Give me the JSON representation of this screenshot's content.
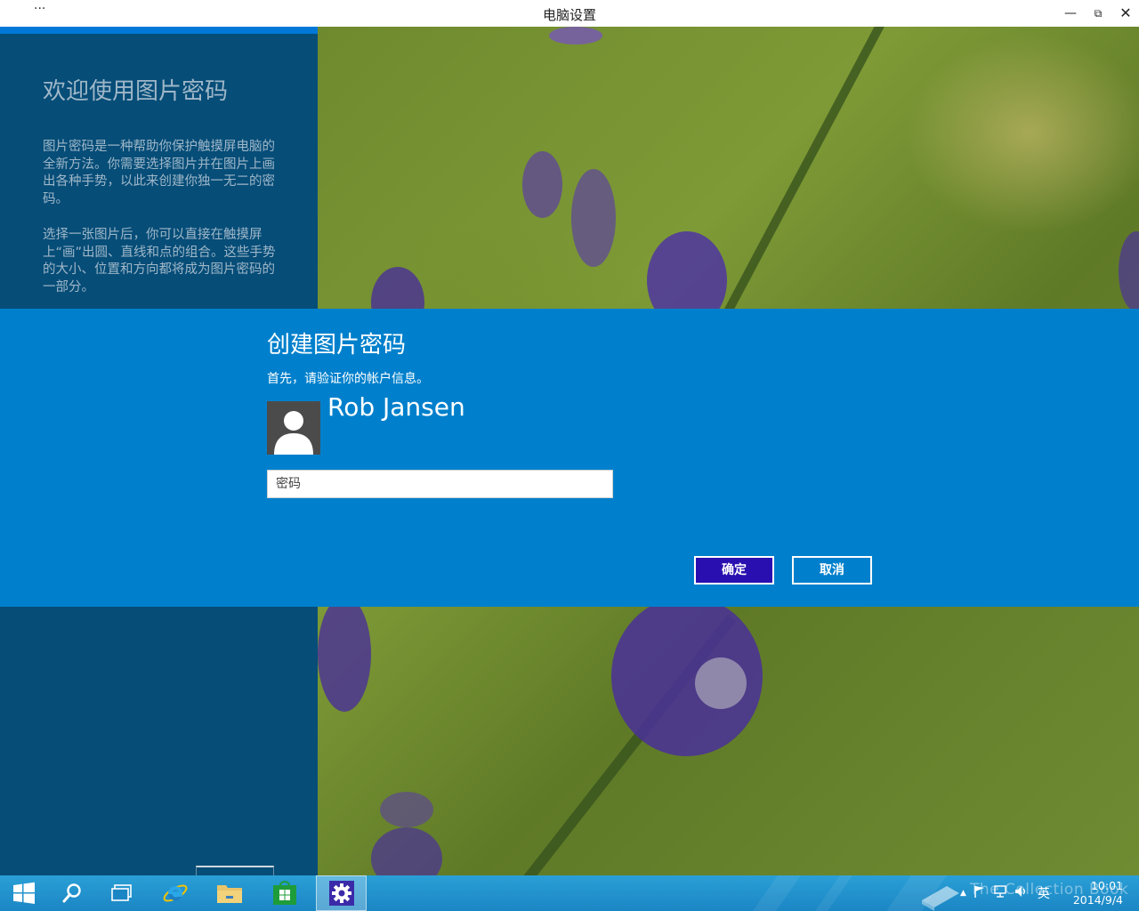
{
  "window": {
    "title": "电脑设置",
    "menu_glyph": "···",
    "minimize_glyph": "—",
    "restore_glyph": "⧉",
    "close_glyph": "✕"
  },
  "left_panel": {
    "heading": "欢迎使用图片密码",
    "paragraph1": "图片密码是一种帮助你保护触摸屏电脑的全新方法。你需要选择图片并在图片上画出各种手势，以此来创建你独一无二的密码。",
    "paragraph2": "选择一张图片后，你可以直接在触摸屏上“画”出圆、直线和点的组合。这些手势的大小、位置和方向都将成为图片密码的一部分。"
  },
  "dialog": {
    "title": "创建图片密码",
    "subtitle": "首先，请验证你的帐户信息。",
    "user_name": "Rob Jansen",
    "password_placeholder": "密码",
    "ok_label": "确定",
    "cancel_label": "取消"
  },
  "taskbar": {
    "icons": [
      "windows-start-icon",
      "search-icon",
      "task-view-icon",
      "internet-explorer-icon",
      "file-explorer-icon",
      "store-icon",
      "settings-gear-icon"
    ],
    "tray_language": "英",
    "tray_up_arrow": "▲",
    "clock_time": "10:01",
    "clock_date": "2014/9/4",
    "watermark": "The Collection Book"
  },
  "colors": {
    "accent_blue": "#0080cc",
    "left_panel": "#064d78",
    "ok_button": "#2a0fb0",
    "taskbar": "#1b86c4"
  }
}
